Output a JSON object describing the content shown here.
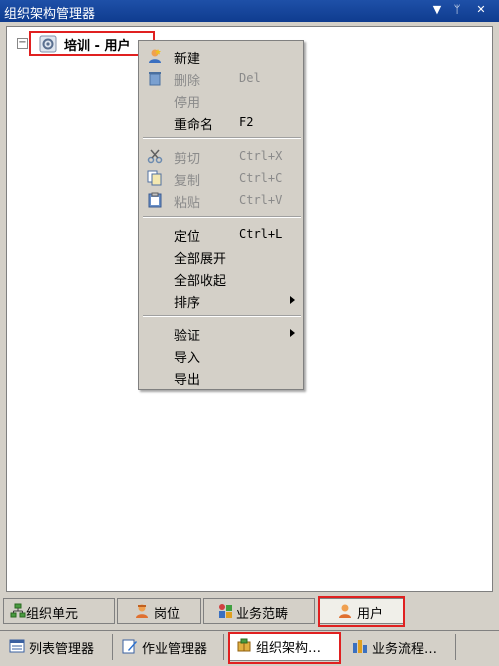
{
  "window": {
    "title": "组织架构管理器",
    "dropdown_glyph": "▼",
    "pin_glyph": "ᛘ",
    "close_glyph": "✕"
  },
  "tree": {
    "expander_glyph": "−",
    "root_label": "培训 - 用户"
  },
  "context_menu": {
    "new": {
      "label": "新建"
    },
    "delete": {
      "label": "删除",
      "shortcut": "Del"
    },
    "disable": {
      "label": "停用"
    },
    "rename": {
      "label": "重命名",
      "shortcut": "F2"
    },
    "cut": {
      "label": "剪切",
      "shortcut": "Ctrl+X"
    },
    "copy": {
      "label": "复制",
      "shortcut": "Ctrl+C"
    },
    "paste": {
      "label": "粘贴",
      "shortcut": "Ctrl+V"
    },
    "locate": {
      "label": "定位",
      "shortcut": "Ctrl+L"
    },
    "expand_all": {
      "label": "全部展开"
    },
    "collapse_all": {
      "label": "全部收起"
    },
    "sort": {
      "label": "排序"
    },
    "validate": {
      "label": "验证"
    },
    "import": {
      "label": "导入"
    },
    "export": {
      "label": "导出"
    }
  },
  "category_tabs": [
    {
      "label": "组织单元"
    },
    {
      "label": "岗位"
    },
    {
      "label": "业务范畴"
    },
    {
      "label": "用户"
    }
  ],
  "manager_tabs": [
    {
      "label": "列表管理器"
    },
    {
      "label": "作业管理器"
    },
    {
      "label": "组织架构…"
    },
    {
      "label": "业务流程…"
    }
  ],
  "colors": {
    "title_bar": "#1e50a8",
    "highlight_border": "#e02020",
    "disabled_text": "#8a8a8a"
  }
}
